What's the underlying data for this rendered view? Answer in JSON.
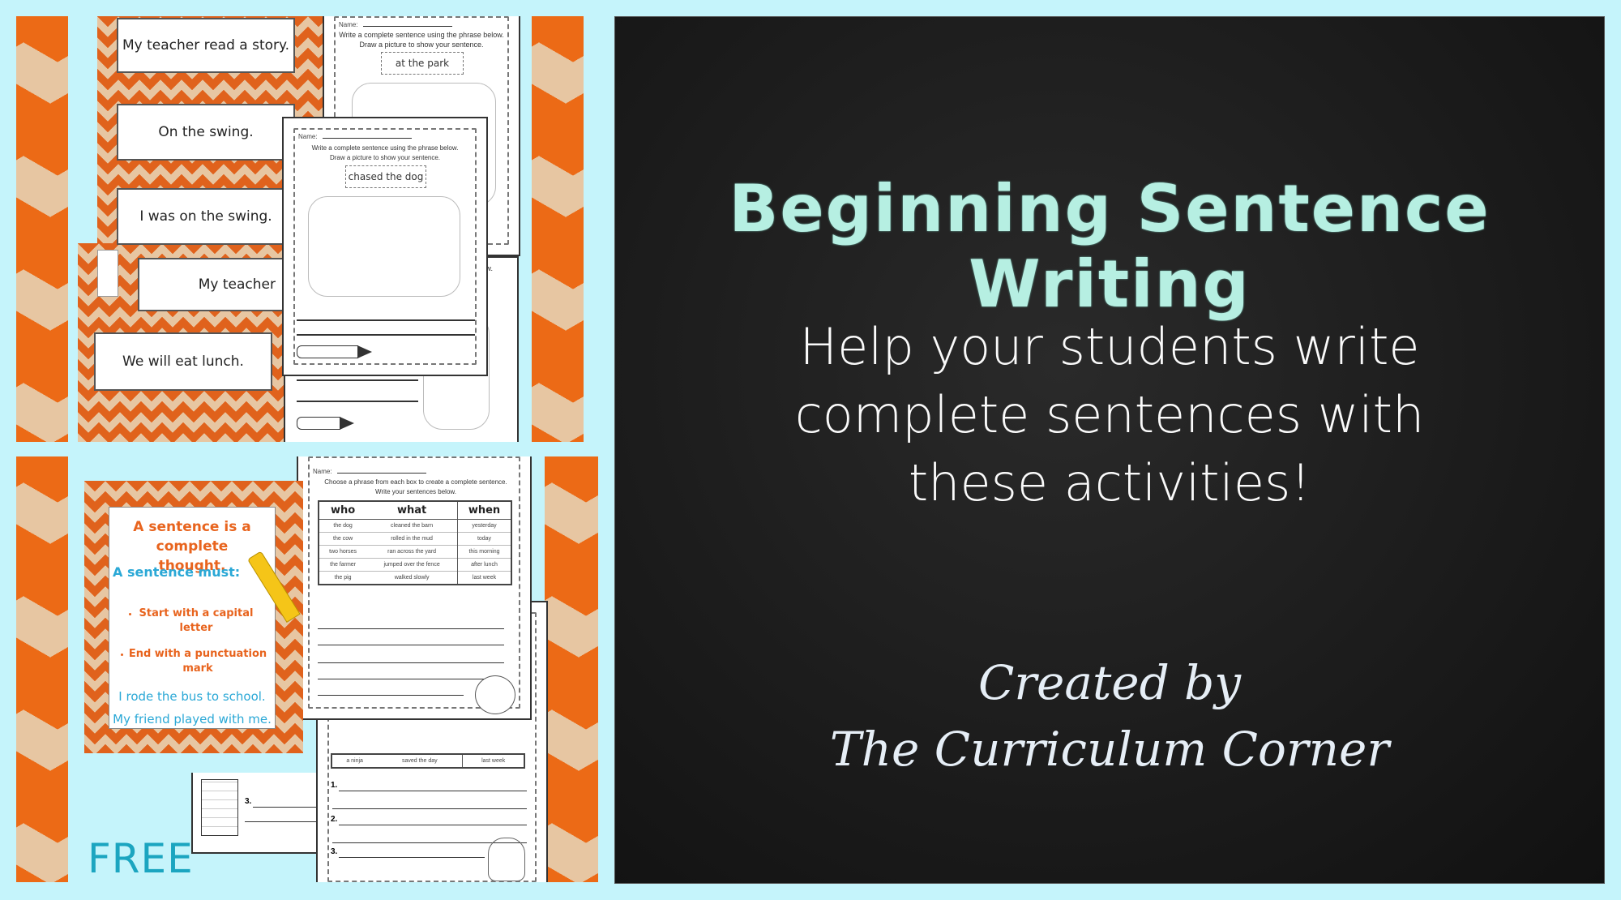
{
  "colors": {
    "background": "#c5f4fb",
    "chevron_orange": "#e8681a",
    "chevron_tan": "#e7c6a2",
    "chalkboard": "#1c1c1c",
    "title_mint": "#b6efe2",
    "poster_orange": "#e8641e",
    "poster_blue": "#2aa8d6",
    "free_blue": "#1ba5c0"
  },
  "top_panel": {
    "sentence_cards": [
      "My teacher read a story.",
      "On the swing.",
      "I was on the swing.",
      "My teacher",
      "We will eat lunch."
    ],
    "worksheet_back": {
      "name_label": "Name:",
      "instruction_1": "Write a complete sentence using the phrase below.",
      "instruction_2": "Draw a picture to show your sentence.",
      "phrase": "at the park",
      "partial_text": "low."
    },
    "worksheet_front": {
      "name_label": "Name:",
      "instruction_1": "Write a complete sentence using the phrase below.",
      "instruction_2": "Draw a picture to show your sentence.",
      "phrase": "chased the dog"
    }
  },
  "bottom_panel": {
    "poster": {
      "heading": "A sentence is a complete thought.",
      "subheading": "A sentence must:",
      "bullets": [
        "Start with a capital letter",
        "End with a punctuation mark"
      ],
      "example_1": "I rode the bus to school.",
      "example_2": "My friend played with me."
    },
    "worksheet": {
      "name_label": "Name:",
      "instructions": "Choose a phrase from each box to create a complete sentence.  Write your sentences below.",
      "columns": [
        "who",
        "what",
        "when"
      ],
      "rows": [
        [
          "the dog",
          "cleaned the barn",
          "yesterday"
        ],
        [
          "the cow",
          "rolled in the mud",
          "today"
        ],
        [
          "two horses",
          "ran across the yard",
          "this morning"
        ],
        [
          "the farmer",
          "jumped over the fence",
          "after lunch"
        ],
        [
          "the pig",
          "walked slowly",
          "last week"
        ]
      ]
    },
    "worksheet_back": {
      "row": [
        "a ninja",
        "saved the day",
        "last week"
      ],
      "numbers": [
        "1.",
        "2.",
        "3."
      ]
    },
    "castle_sheet_number": "3.",
    "free_label": "FREE"
  },
  "chalkboard": {
    "title": "Beginning Sentence Writing",
    "subtitle_lines": [
      "Help your students write",
      "complete sentences with",
      "these activities!"
    ],
    "credit_lines": [
      "Created by",
      "The Curriculum Corner"
    ]
  }
}
